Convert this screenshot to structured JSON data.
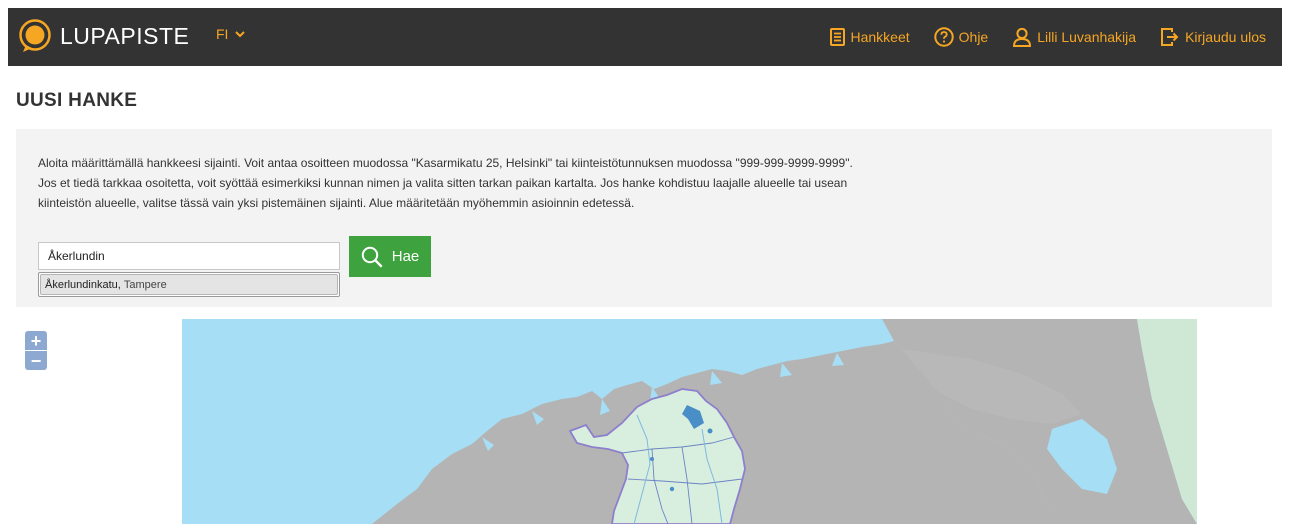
{
  "header": {
    "logo_text": "LUPAPISTE",
    "language": "FI",
    "nav": {
      "projects": "Hankkeet",
      "help": "Ohje",
      "user": "Lilli Luvanhakija",
      "logout": "Kirjaudu ulos"
    }
  },
  "page": {
    "title": "UUSI HANKE"
  },
  "intro": {
    "line1": "Aloita määrittämällä hankkeesi sijainti. Voit antaa osoitteen muodossa \"Kasarmikatu 25, Helsinki\" tai kiinteistötunnuksen muodossa \"999-999-9999-9999\".",
    "line2": "Jos et tiedä tarkkaa osoitetta, voit syöttää esimerkiksi kunnan nimen ja valita sitten tarkan paikan kartalta. Jos hanke kohdistuu laajalle alueelle tai usean",
    "line3": "kiinteistön alueelle, valitse tässä vain yksi pistemäinen sijainti. Alue määritetään myöhemmin asioinnin edetessä."
  },
  "search": {
    "value": "Åkerlundin",
    "button_label": "Hae",
    "suggestions": [
      {
        "street": "Åkerlundinkatu",
        "city": "Tampere"
      }
    ]
  },
  "map": {
    "zoom_in": "+",
    "zoom_out": "−"
  },
  "colors": {
    "topbar": "#333333",
    "accent": "#f5a623",
    "button_green": "#3ea33e",
    "map_sea": "#a6dff5",
    "map_land": "#b4b4b4",
    "finland_fill": "#d8efdf",
    "border": "#8e7fcc"
  }
}
